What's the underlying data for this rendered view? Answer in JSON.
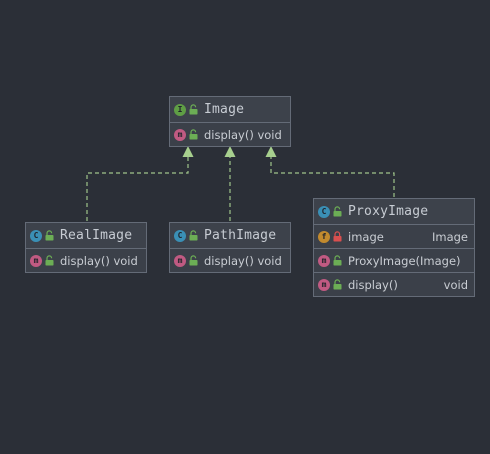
{
  "diagram": {
    "colors": {
      "background": "#2b2f37",
      "box_fill": "#3b4049",
      "box_border": "#646b77",
      "edge": "#9fc48a",
      "interface_badge": "#5f9e45",
      "class_badge": "#3a8fb5",
      "method_badge": "#c05a82",
      "field_badge": "#c28a2e",
      "public_icon": "#6cae55",
      "private_icon": "#d94f4f"
    },
    "image": {
      "kind_letter": "I",
      "name": "Image",
      "methods": [
        {
          "letter": "m",
          "name": "display() void",
          "visibility": "public"
        }
      ]
    },
    "real_image": {
      "kind_letter": "C",
      "name": "RealImage",
      "methods": [
        {
          "letter": "m",
          "name": "display() void",
          "visibility": "public"
        }
      ]
    },
    "path_image": {
      "kind_letter": "C",
      "name": "PathImage",
      "methods": [
        {
          "letter": "m",
          "name": "display() void",
          "visibility": "public"
        }
      ]
    },
    "proxy_image": {
      "kind_letter": "C",
      "name": "ProxyImage",
      "fields": [
        {
          "letter": "f",
          "name": "image",
          "type": "Image",
          "visibility": "private"
        }
      ],
      "methods": [
        {
          "letter": "m",
          "name": "ProxyImage(Image)",
          "type": "",
          "visibility": "public"
        },
        {
          "letter": "m",
          "name": "display()",
          "type": "void",
          "visibility": "public"
        }
      ]
    },
    "relations": [
      {
        "from": "RealImage",
        "to": "Image",
        "kind": "implements"
      },
      {
        "from": "PathImage",
        "to": "Image",
        "kind": "implements"
      },
      {
        "from": "ProxyImage",
        "to": "Image",
        "kind": "implements"
      }
    ]
  }
}
